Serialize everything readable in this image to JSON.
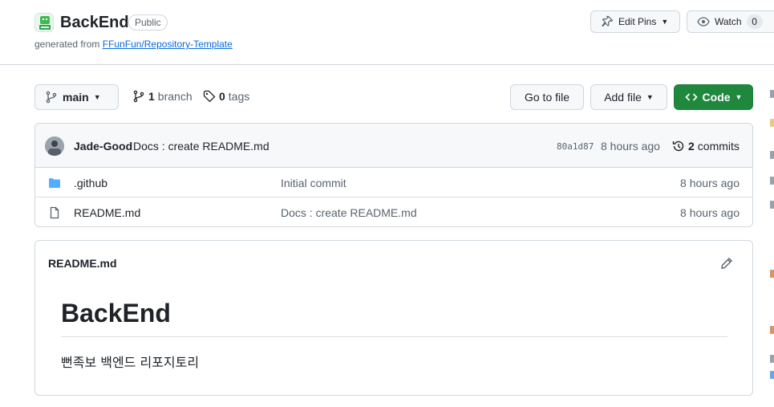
{
  "repo": {
    "name": "BackEnd",
    "visibility": "Public",
    "generated_prefix": "generated from",
    "template_link": "FFunFun/Repository-Template"
  },
  "actions": {
    "edit_pins": "Edit Pins",
    "watch": "Watch",
    "watch_count": "0"
  },
  "toolbar": {
    "branch": "main",
    "branch_count": "1",
    "branch_label": "branch",
    "tag_count": "0",
    "tag_label": "tags",
    "go_to_file": "Go to file",
    "add_file": "Add file",
    "code": "Code"
  },
  "latest_commit": {
    "author": "Jade-Good",
    "message": "Docs : create README.md",
    "sha": "80a1d87",
    "time": "8 hours ago",
    "commit_count": "2",
    "commit_label": "commits"
  },
  "files": [
    {
      "name": ".github",
      "type": "folder",
      "commit": "Initial commit",
      "time": "8 hours ago"
    },
    {
      "name": "README.md",
      "type": "file",
      "commit": "Docs : create README.md",
      "time": "8 hours ago"
    }
  ],
  "readme": {
    "filename": "README.md",
    "heading": "BackEnd",
    "body": "뻔족보 백엔드 리포지토리"
  },
  "colors": {
    "accent": "#0969da",
    "code_button": "#1f883d",
    "border": "#d0d7de",
    "muted_text": "#59636e"
  }
}
